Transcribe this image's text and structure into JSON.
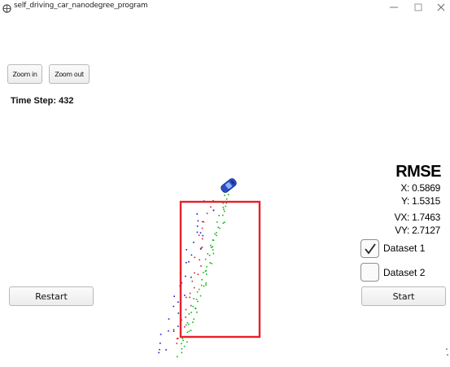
{
  "window": {
    "title": "self_driving_car_nanodegree_program"
  },
  "toolbar": {
    "zoom_in_label": "Zoom in",
    "zoom_out_label": "Zoom out"
  },
  "status": {
    "time_step": "Time Step: 432"
  },
  "rmse": {
    "title": "RMSE",
    "x": "X: 0.5869",
    "y": "Y: 1.5315",
    "vx": "VX: 1.7463",
    "vy": "VY: 2.7127"
  },
  "datasets": [
    {
      "label": "Dataset 1",
      "checked": true
    },
    {
      "label": "Dataset 2",
      "checked": false
    }
  ],
  "controls": {
    "restart_label": "Restart",
    "start_label": "Start"
  },
  "colors": {
    "highlight_box": "#e8202a",
    "car": "#2b4fc7",
    "lidar": "#d42020",
    "radar": "#1a1ad0",
    "estimate": "#18b018"
  }
}
